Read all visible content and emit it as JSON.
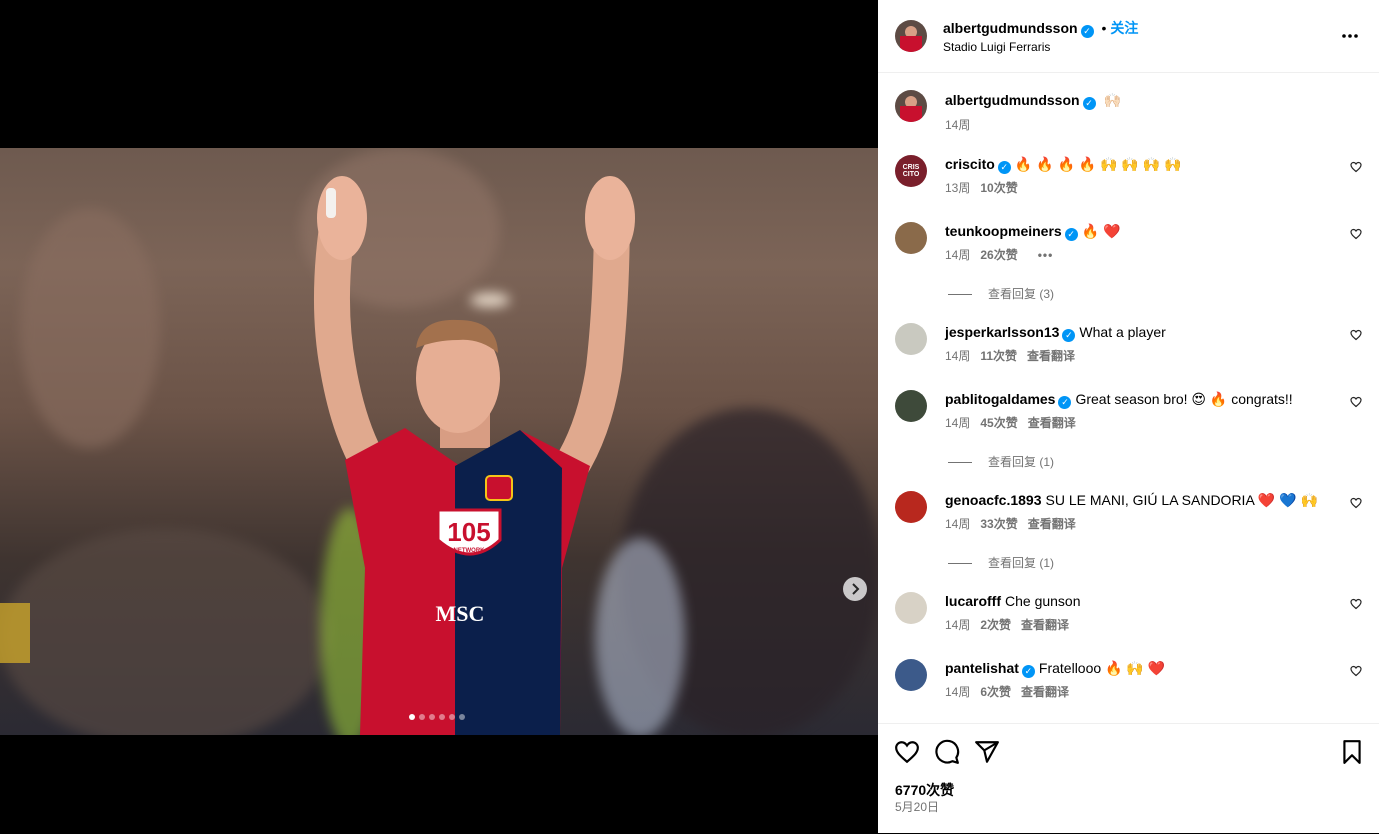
{
  "post": {
    "username": "albertgudmundsson",
    "follow_label": "关注",
    "location": "Stadio Luigi Ferraris",
    "caption": "🙌🏻",
    "caption_age": "14周",
    "sponsor_badge": "105",
    "sponsor_badge_sub": "NETWORK",
    "shirt_sponsor": "MSC",
    "carousel_count": 6
  },
  "comments": [
    {
      "user": "criscito",
      "verified": true,
      "text": "🔥 🔥 🔥 🔥 🙌 🙌 🙌 🙌",
      "age": "13周",
      "likes": "10次赞",
      "translate": "",
      "replies": "",
      "avatar_color": "#7a1f2b",
      "avatar_text": "CRIS CITO"
    },
    {
      "user": "teunkoopmeiners",
      "verified": true,
      "text": "🔥 ❤️",
      "age": "14周",
      "likes": "26次赞",
      "translate": "",
      "more": "•••",
      "replies": "查看回复 (3)",
      "avatar_color": "#8a6a4a",
      "avatar_text": ""
    },
    {
      "user": "jesperkarlsson13",
      "verified": true,
      "text": "What a player",
      "age": "14周",
      "likes": "11次赞",
      "translate": "查看翻译",
      "replies": "",
      "avatar_color": "#c9c9c0",
      "avatar_text": ""
    },
    {
      "user": "pablitogaldames",
      "verified": true,
      "text": "Great season bro! 😍 🔥 congrats!!",
      "age": "14周",
      "likes": "45次赞",
      "translate": "查看翻译",
      "replies": "查看回复 (1)",
      "avatar_color": "#3e4a3a",
      "avatar_text": ""
    },
    {
      "user": "genoacfc.1893",
      "verified": false,
      "text": "SU LE MANI, GIÚ LA SANDORIA ❤️ 💙 🙌",
      "age": "14周",
      "likes": "33次赞",
      "translate": "查看翻译",
      "replies": "查看回复 (1)",
      "avatar_color": "#b8281e",
      "avatar_text": ""
    },
    {
      "user": "lucarofff",
      "verified": false,
      "text": "Che gunson",
      "age": "14周",
      "likes": "2次赞",
      "translate": "查看翻译",
      "replies": "",
      "avatar_color": "#d8d2c6",
      "avatar_text": ""
    },
    {
      "user": "pantelishat",
      "verified": true,
      "text": "Fratellooo 🔥 🙌 ❤️",
      "age": "14周",
      "likes": "6次赞",
      "translate": "查看翻译",
      "replies": "",
      "avatar_color": "#3c5a8a",
      "avatar_text": ""
    }
  ],
  "footer": {
    "likes": "6770次赞",
    "date": "5月20日"
  },
  "colors": {
    "accent": "#0095f6",
    "muted": "#737373",
    "genoa_red": "#c8102e",
    "genoa_blue": "#0b1f4b"
  }
}
